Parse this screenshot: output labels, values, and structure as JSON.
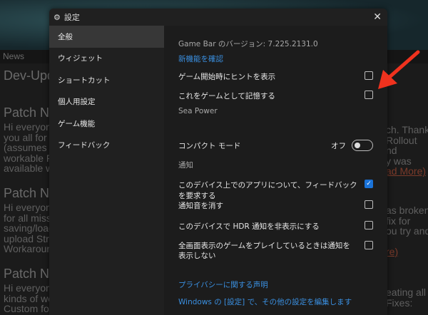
{
  "background": {
    "news_tab": "News",
    "left": {
      "title": "Dev-Upda",
      "sections": [
        {
          "title": "Patch No",
          "lines": [
            "Hi everyone",
            "you all for y",
            "(assumes p",
            "workable Fl",
            "available wh"
          ]
        },
        {
          "title": "Patch No",
          "lines": [
            "Hi everyone",
            "for all missi",
            "saving/load",
            "upload Strea",
            "Workaround"
          ]
        },
        {
          "title": "Patch No",
          "lines": [
            "Hi everyone",
            "kinds of wei",
            "Custom for"
          ]
        }
      ]
    },
    "right": {
      "block1": [
        "ch. Thank",
        "Rollout",
        "nd",
        "y was"
      ],
      "link1": "ad More)",
      "block2": [
        "as broken",
        "fix for",
        "ou try and"
      ],
      "link2": "re)",
      "block3": [
        "eating all",
        "Fixes:"
      ]
    }
  },
  "dialog": {
    "title": "設定",
    "sidebar": [
      "全般",
      "ウィジェット",
      "ショートカット",
      "個人用設定",
      "ゲーム機能",
      "フィードバック"
    ],
    "version": "Game Bar のバージョン: 7.225.2131.0",
    "whats_new": "新機能を確認",
    "hints": {
      "label": "ゲーム開始時にヒントを表示",
      "checked": false
    },
    "remember": {
      "label": "これをゲームとして記憶する",
      "checked": false
    },
    "game_name": "Sea Power",
    "compact": {
      "label": "コンパクト モード",
      "state": "オフ"
    },
    "notifications_header": "通知",
    "notif": [
      {
        "label": "このデバイス上でのアプリについて、フィードバックを要求する",
        "checked": true
      },
      {
        "label": "通知音を消す",
        "checked": false
      },
      {
        "label": "このデバイスで HDR 通知を非表示にする",
        "checked": false
      },
      {
        "label": "全画面表示のゲームをプレイしているときは通知を表示しない",
        "checked": false
      }
    ],
    "privacy": "プライバシーに関する声明",
    "windows_settings": "Windows の [設定] で、その他の設定を編集します",
    "check": "✓"
  },
  "colors": {
    "accent": "#1a73d9",
    "arrow": "#f0321e"
  }
}
